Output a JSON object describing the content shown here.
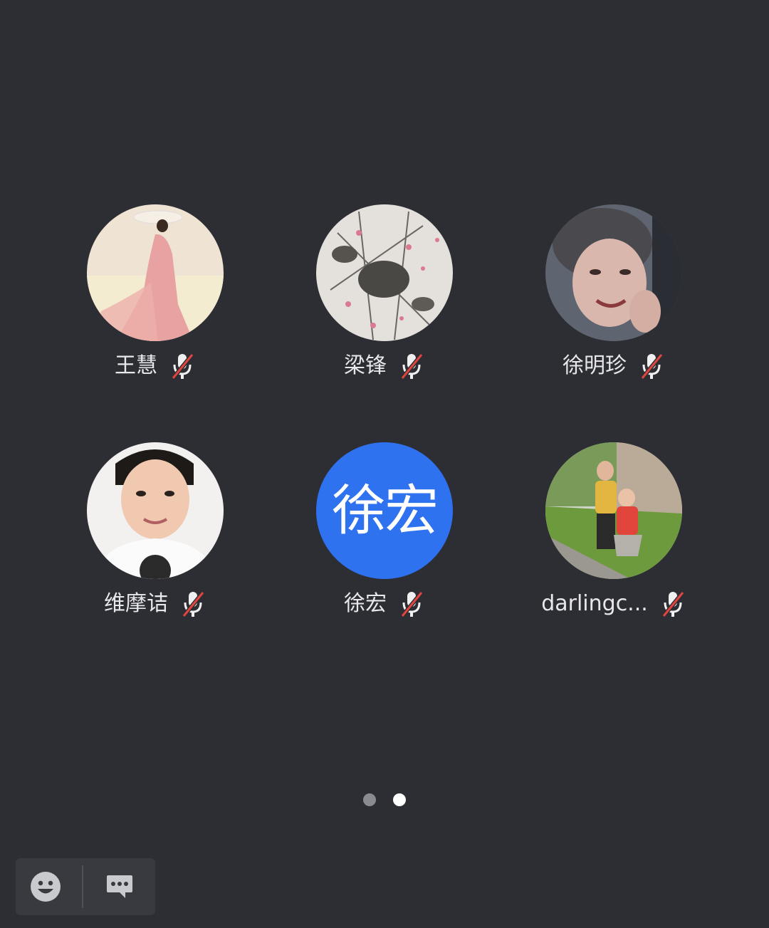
{
  "participants": [
    {
      "name": "王慧",
      "avatar": "photo-woman-pink-dress",
      "muted": true
    },
    {
      "name": "梁锋",
      "avatar": "ink-painting-flowers",
      "muted": true
    },
    {
      "name": "徐明珍",
      "avatar": "photo-smiling-woman",
      "muted": true
    },
    {
      "name": "维摩诘",
      "avatar": "photo-young-man",
      "muted": true
    },
    {
      "name": "徐宏",
      "avatar_text": "徐宏",
      "avatar_color": "#2f72f0",
      "muted": true
    },
    {
      "name": "darlingc...",
      "avatar": "photo-two-children",
      "muted": true
    }
  ],
  "pager": {
    "count": 2,
    "active_index": 1
  },
  "toolbar": {
    "buttons": [
      {
        "icon": "emoji-icon"
      },
      {
        "icon": "chat-bubble-icon"
      }
    ]
  },
  "colors": {
    "background": "#2d2e33",
    "muted_slash": "#e0453e",
    "avatar_blue": "#2f72f0"
  }
}
